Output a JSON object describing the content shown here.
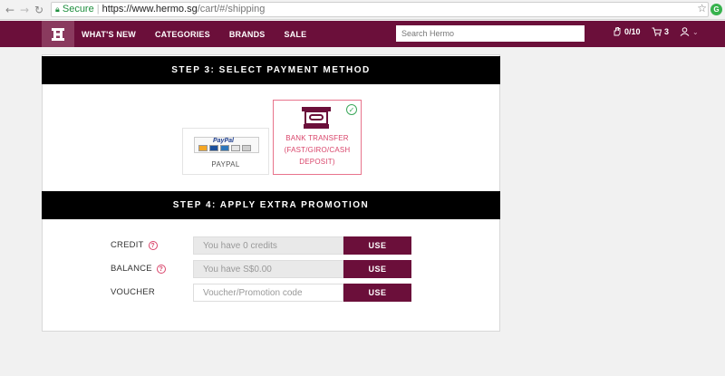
{
  "browser": {
    "back_icon": "←",
    "forward_icon": "→",
    "reload_icon": "↻",
    "secure_label": "Secure",
    "url_host": "https://www.hermo.sg",
    "url_path": "/cart/#/shipping",
    "star_icon": "☆",
    "extension_letter": "G"
  },
  "header": {
    "menu": [
      "WHAT'S NEW",
      "CATEGORIES",
      "BRANDS",
      "SALE"
    ],
    "search_placeholder": "Search Hermo",
    "wishlist_count": "0/10",
    "cart_count": "3",
    "account_caret": "⌄"
  },
  "step3": {
    "title": "STEP 3: SELECT PAYMENT METHOD",
    "options": [
      {
        "label": "PAYPAL",
        "selected": false
      },
      {
        "label": "BANK TRANSFER (FAST/GIRO/CASH DEPOSIT)",
        "selected": true
      }
    ],
    "paypal_logo_text": "PayPal"
  },
  "step4": {
    "title": "STEP 4: APPLY EXTRA PROMOTION",
    "rows": [
      {
        "label": "CREDIT",
        "help": "?",
        "placeholder": "You have 0 credits",
        "button": "USE"
      },
      {
        "label": "BALANCE",
        "help": "?",
        "placeholder": "You have S$0.00",
        "button": "USE"
      },
      {
        "label": "VOUCHER",
        "placeholder": "Voucher/Promotion code",
        "button": "USE"
      }
    ]
  },
  "colors": {
    "brand": "#6b0f3a",
    "accent_pink": "#d9456b",
    "check_green": "#3aa85a"
  }
}
